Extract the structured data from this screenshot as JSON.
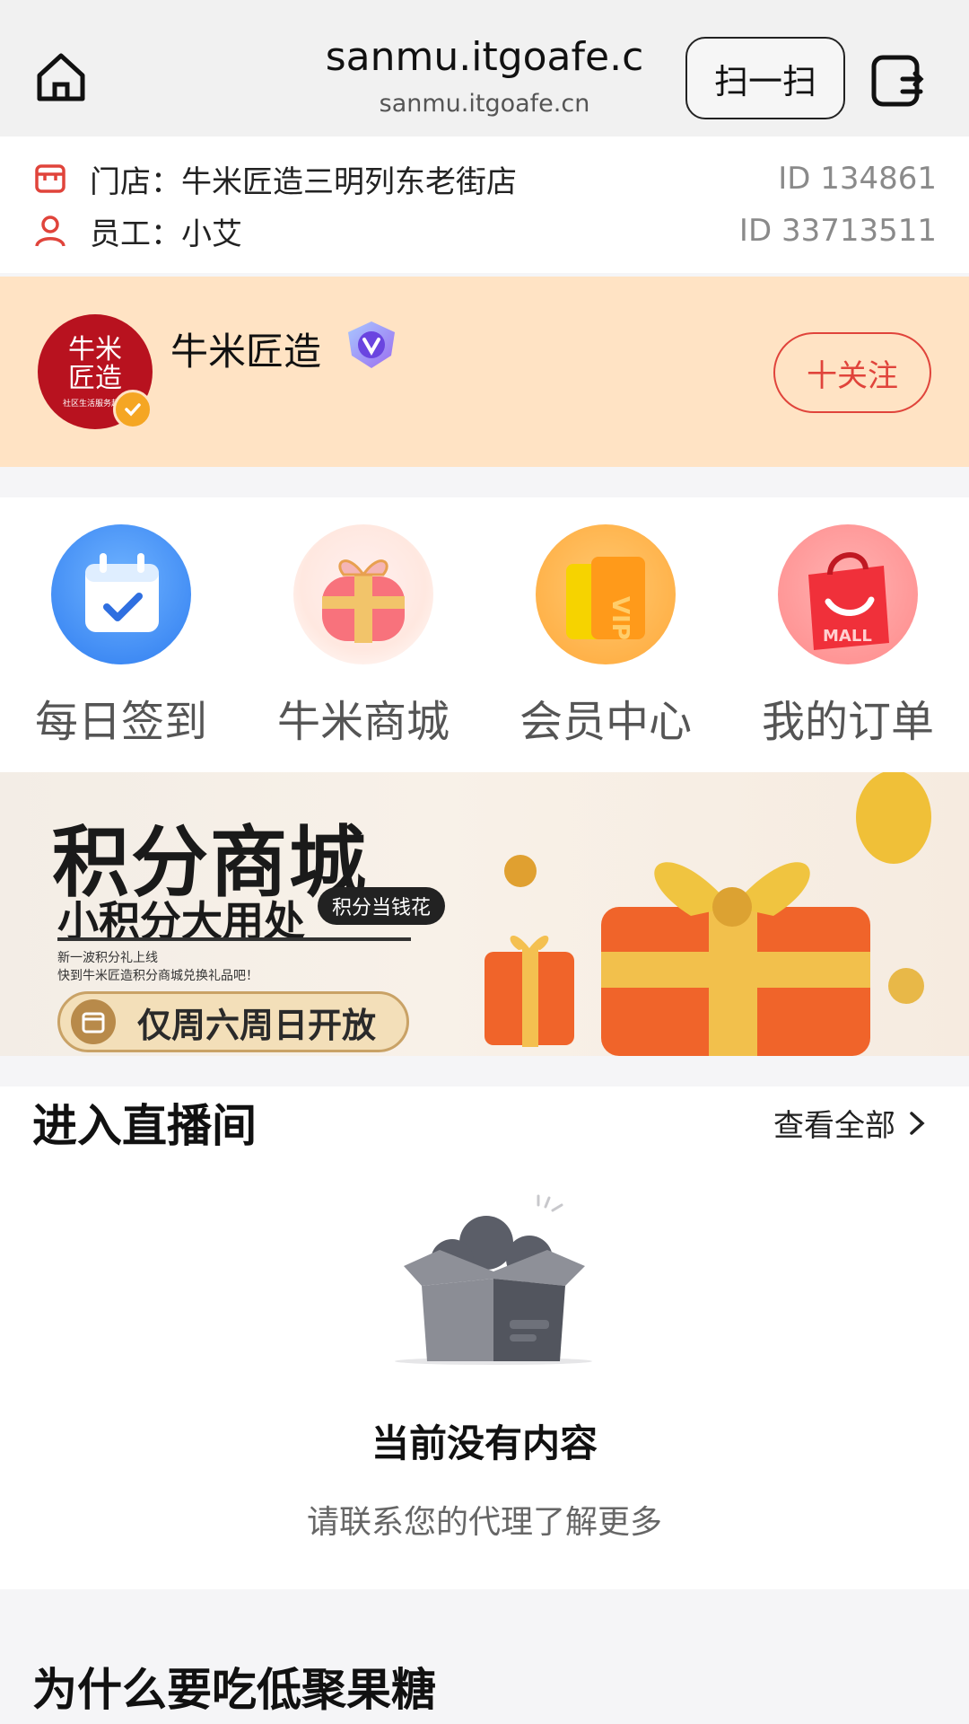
{
  "browser": {
    "url_main": "sanmu.itgoafe.c",
    "url_sub": "sanmu.itgoafe.cn",
    "scan_label": "扫一扫",
    "home_icon": "home-icon",
    "tabs_icon": "tabs-switch-icon"
  },
  "store": {
    "store_label": "门店：",
    "store_name": "牛米匠造三明列东老街店",
    "store_id": "ID 134861",
    "staff_label": "员工：",
    "staff_name": "小艾",
    "staff_id": "ID 33713511"
  },
  "brand": {
    "logo_line1": "牛米",
    "logo_line2": "匠造",
    "logo_small": "社区生活服务超市",
    "name": "牛米匠造",
    "follow_label": "十关注",
    "accent": "#e0443b",
    "background": "#ffe3c4"
  },
  "quick_entries": [
    {
      "label": "每日签到",
      "icon": "calendar-check-icon"
    },
    {
      "label": "牛米商城",
      "icon": "gift-box-icon"
    },
    {
      "label": "会员中心",
      "icon": "vip-card-icon"
    },
    {
      "label": "我的订单",
      "icon": "shopping-bag-icon"
    }
  ],
  "banner": {
    "title": "积分商城",
    "subtitle": "小积分大用处",
    "tag": "积分当钱花",
    "small_line1": "新一波积分礼上线",
    "small_line2": "快到牛米匠造积分商城兑换礼品吧！",
    "pill_text": "仅周六周日开放"
  },
  "live": {
    "title": "进入直播间",
    "see_all": "查看全部",
    "empty_title": "当前没有内容",
    "empty_sub": "请联系您的代理了解更多"
  },
  "next_section": {
    "title": "为什么要吃低聚果糖"
  }
}
